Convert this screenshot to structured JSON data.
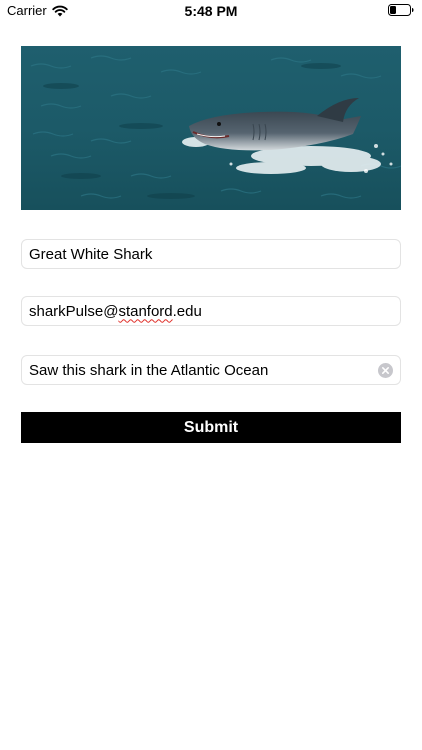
{
  "status_bar": {
    "carrier": "Carrier",
    "time": "5:48 PM",
    "icons": [
      "wifi-icon",
      "battery-icon"
    ]
  },
  "hero": {
    "content": "great white shark breaching ocean water"
  },
  "form": {
    "name_value": "Great White Shark",
    "email_parts": [
      "sharkPulse@",
      "stanford",
      ".edu"
    ],
    "comment_value": "Saw this shark in the Atlantic Ocean",
    "clear_icon": "clear-circle-icon",
    "submit_label": "Submit"
  },
  "colors": {
    "button_bg": "#000000",
    "button_text": "#ffffff",
    "field_border": "#e3e3e3",
    "spellcheck": "#e0302a"
  }
}
